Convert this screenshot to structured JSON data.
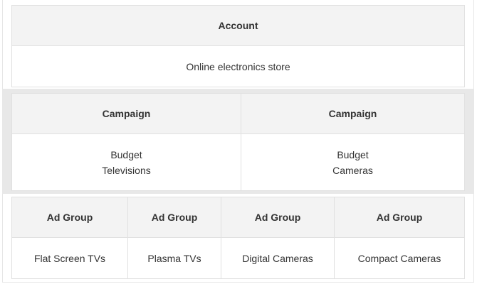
{
  "account": {
    "header": "Account",
    "value": "Online electronics store"
  },
  "campaigns": [
    {
      "header": "Campaign",
      "lines": [
        "Budget",
        "Televisions"
      ]
    },
    {
      "header": "Campaign",
      "lines": [
        "Budget",
        "Cameras"
      ]
    }
  ],
  "ad_groups": [
    {
      "header": "Ad Group",
      "value": "Flat Screen TVs"
    },
    {
      "header": "Ad Group",
      "value": "Plasma TVs"
    },
    {
      "header": "Ad Group",
      "value": "Digital Cameras"
    },
    {
      "header": "Ad Group",
      "value": "Compact Cameras"
    }
  ],
  "colors": {
    "header_bg": "#f3f3f3",
    "band_bg": "#e8e8e8",
    "border": "#e1e1e1",
    "text": "#333333"
  }
}
